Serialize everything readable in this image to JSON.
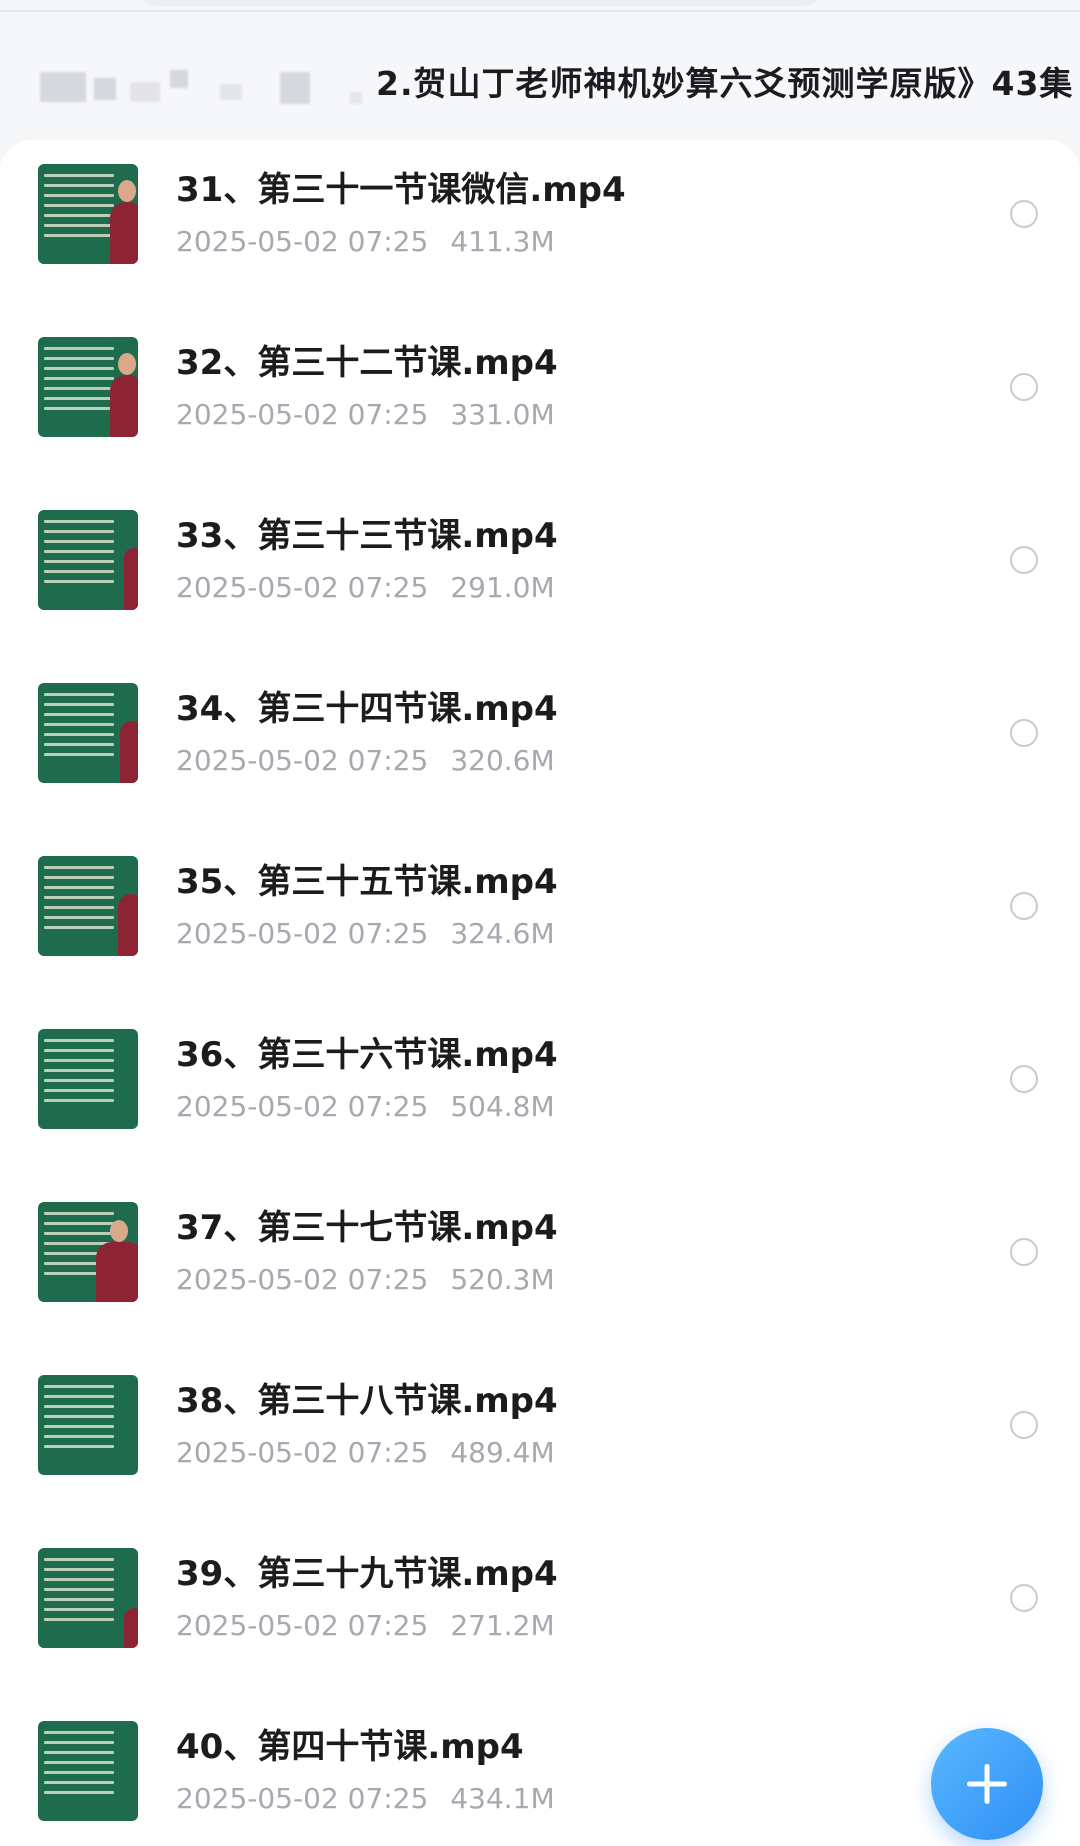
{
  "breadcrumb": {
    "title": "2.贺山丁老师神机妙算六爻预测学原版》43集"
  },
  "files": [
    {
      "name": "31、第三十一节课微信.mp4",
      "date": "2025-05-02 07:25",
      "size": "411.3M"
    },
    {
      "name": "32、第三十二节课.mp4",
      "date": "2025-05-02 07:25",
      "size": "331.0M"
    },
    {
      "name": "33、第三十三节课.mp4",
      "date": "2025-05-02 07:25",
      "size": "291.0M"
    },
    {
      "name": "34、第三十四节课.mp4",
      "date": "2025-05-02 07:25",
      "size": "320.6M"
    },
    {
      "name": "35、第三十五节课.mp4",
      "date": "2025-05-02 07:25",
      "size": "324.6M"
    },
    {
      "name": "36、第三十六节课.mp4",
      "date": "2025-05-02 07:25",
      "size": "504.8M"
    },
    {
      "name": "37、第三十七节课.mp4",
      "date": "2025-05-02 07:25",
      "size": "520.3M"
    },
    {
      "name": "38、第三十八节课.mp4",
      "date": "2025-05-02 07:25",
      "size": "489.4M"
    },
    {
      "name": "39、第三十九节课.mp4",
      "date": "2025-05-02 07:25",
      "size": "271.2M"
    },
    {
      "name": "40、第四十节课.mp4",
      "date": "2025-05-02 07:25",
      "size": "434.1M"
    }
  ],
  "fab": {
    "icon": "plus-icon"
  },
  "colors": {
    "background": "#f6f7f9",
    "card": "#ffffff",
    "title_text": "#1c1c1e",
    "meta_text": "#a6a9b0",
    "accent": "#2f8ff5",
    "thumbnail": "#1f6b4d"
  }
}
